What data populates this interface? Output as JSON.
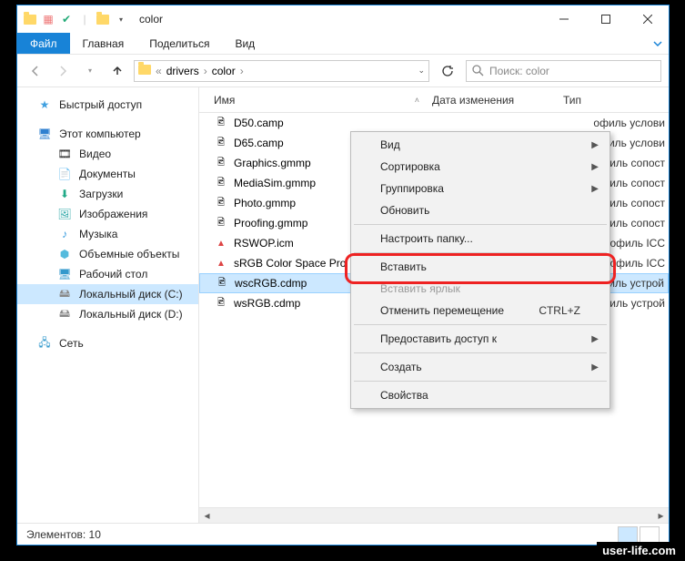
{
  "title": "color",
  "menubar": {
    "file": "Файл",
    "tabs": [
      "Главная",
      "Поделиться",
      "Вид"
    ]
  },
  "breadcrumb": {
    "prefix": "«",
    "parts": [
      "drivers",
      "color"
    ]
  },
  "search": {
    "placeholder": "Поиск: color"
  },
  "sidebar": {
    "quick": "Быстрый доступ",
    "thispc": "Этот компьютер",
    "items": [
      "Видео",
      "Документы",
      "Загрузки",
      "Изображения",
      "Музыка",
      "Объемные объекты",
      "Рабочий стол",
      "Локальный диск (C:)",
      "Локальный диск (D:)"
    ],
    "network": "Сеть"
  },
  "columns": {
    "name": "Имя",
    "date": "Дата изменения",
    "type": "Тип"
  },
  "files": [
    {
      "name": "D50.camp",
      "type": "офиль услови"
    },
    {
      "name": "D65.camp",
      "type": "офиль услови"
    },
    {
      "name": "Graphics.gmmp",
      "type": "офиль сопост"
    },
    {
      "name": "MediaSim.gmmp",
      "type": "офиль сопост"
    },
    {
      "name": "Photo.gmmp",
      "type": "офиль сопост"
    },
    {
      "name": "Proofing.gmmp",
      "type": "офиль сопост"
    },
    {
      "name": "RSWOP.icm",
      "type": "офиль ICC"
    },
    {
      "name": "sRGB Color Space Pro",
      "type": "офиль ICC"
    },
    {
      "name": "wscRGB.cdmp",
      "type": "офиль устрой"
    },
    {
      "name": "wsRGB.cdmp",
      "type": "офиль устрой"
    }
  ],
  "context": {
    "view": "Вид",
    "sort": "Сортировка",
    "group": "Группировка",
    "refresh": "Обновить",
    "customize": "Настроить папку...",
    "paste": "Вставить",
    "pasteShortcut": "Вставить ярлык",
    "undo": "Отменить перемещение",
    "undoKey": "CTRL+Z",
    "share": "Предоставить доступ к",
    "new": "Создать",
    "properties": "Свойства"
  },
  "status": {
    "elements": "Элементов: 10"
  },
  "watermark": "user-life.com"
}
